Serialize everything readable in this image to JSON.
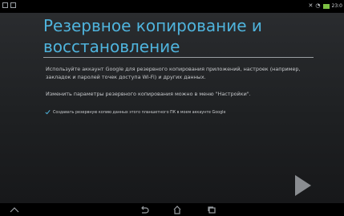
{
  "status_bar": {
    "left_icons": [
      "notification-icon",
      "screenshot-icon"
    ],
    "right_icons": [
      "mute-icon",
      "wifi-icon",
      "battery-icon"
    ],
    "battery_color": "#7cc043",
    "time": "23:0"
  },
  "wizard": {
    "title": "Резервное копирование и восстановление",
    "accent_color": "#4fb4dd",
    "paragraph1": "Используйте аккаунт Google для резервного копирования приложений, настроек (например, закладок и паролей точек доступа Wi-Fi) и других данных.",
    "paragraph2": "Изменить параметры резервного копирования можно в меню \"Настройки\".",
    "checkbox": {
      "checked": true,
      "label": "Создавать резервную копию данных этого планшетного ПК в моем аккаунте Google"
    },
    "next_icon": "next-arrow-icon"
  },
  "nav_bar": {
    "buttons": [
      "keyboard-hide-icon",
      "back-icon",
      "home-icon",
      "recent-apps-icon"
    ]
  }
}
